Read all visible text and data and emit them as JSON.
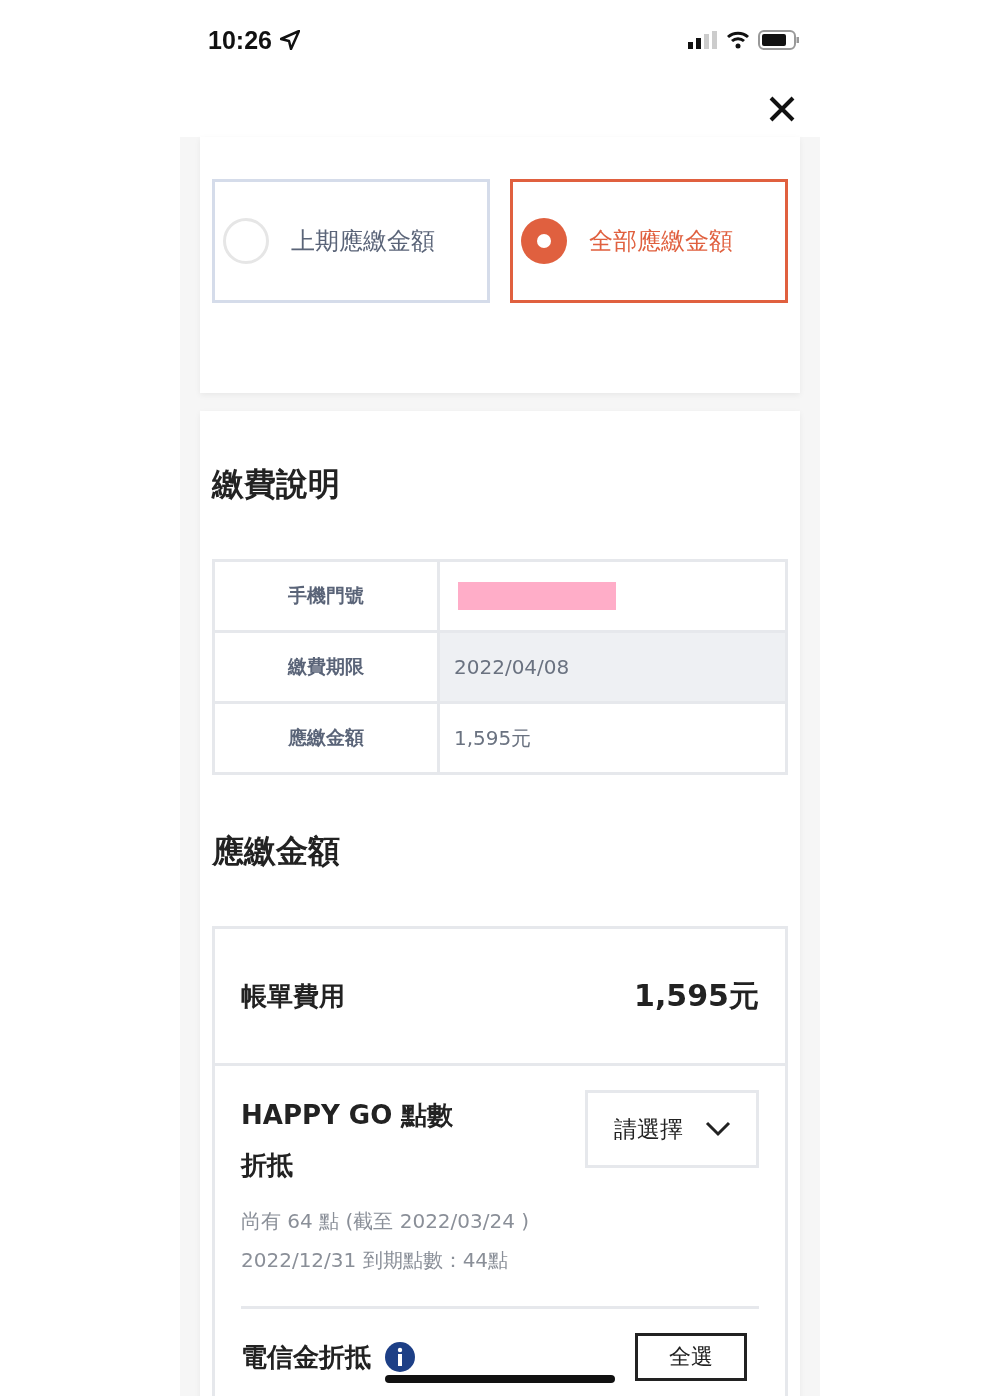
{
  "status_bar": {
    "time": "10:26"
  },
  "bill_choice": {
    "options": [
      {
        "label": "上期應繳金額",
        "selected": false
      },
      {
        "label": "全部應繳金額",
        "selected": true
      }
    ]
  },
  "payment_info": {
    "title": "繳費說明",
    "rows": [
      {
        "label": "手機門號",
        "redacted": true,
        "highlighted": false
      },
      {
        "label": "繳費期限",
        "value": "2022/04/08",
        "highlighted": true
      },
      {
        "label": "應繳金額",
        "value": "1,595元",
        "highlighted": false
      }
    ]
  },
  "amount_due": {
    "title": "應繳金額",
    "bill": {
      "label": "帳單費用",
      "amount": "1,595元"
    },
    "happy_go": {
      "label_line1": "HAPPY GO 點數",
      "label_line2": "折抵",
      "select": {
        "placeholder": "請選擇"
      },
      "notes": [
        "尚有 64 點 (截至 2022/03/24 )",
        "2022/12/31 到期點數：44點"
      ]
    },
    "telecom": {
      "label": "電信金折抵",
      "button": "全選"
    }
  }
}
